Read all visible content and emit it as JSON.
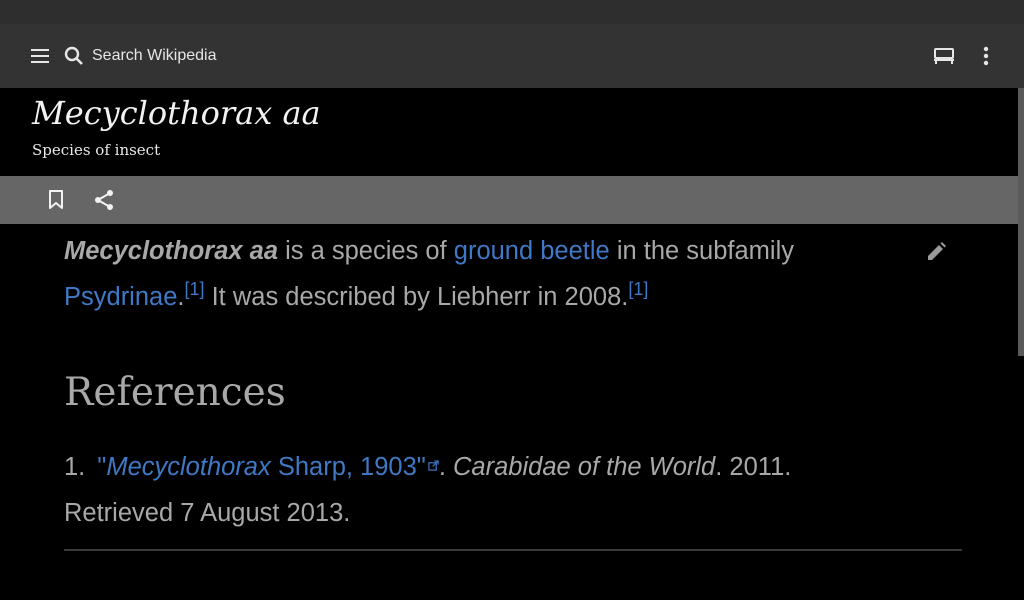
{
  "toolbar": {
    "search_placeholder": "Search Wikipedia",
    "menu_icon": "hamburger-menu-icon",
    "search_icon": "search-icon",
    "reading_list_icon": "reading-list-icon",
    "overflow_icon": "more-vertical-icon"
  },
  "article": {
    "title": "Mecyclothorax aa",
    "description": "Species of insect",
    "actions": {
      "save_icon": "bookmark-icon",
      "share_icon": "share-icon"
    },
    "lead": {
      "term": "Mecyclothorax aa",
      "text1": " is a species of ",
      "link1": "ground beetle",
      "text2": " in the subfamily ",
      "link2": "Psydrinae",
      "text3": ".",
      "ref1": "[1]",
      "text4": " It was described by Liebherr in 2008.",
      "ref2": "[1]"
    },
    "edit_icon": "pencil-icon",
    "references_heading": "References",
    "references": [
      {
        "number": "1.",
        "title_italic": "Mecyclothorax",
        "title_rest": " Sharp, 1903",
        "quote_open": "\"",
        "quote_close": "\"",
        "sep": ". ",
        "work": "Carabidae of the World",
        "tail1": ". 2011.",
        "tail2": "Retrieved 7 August 2013."
      }
    ]
  },
  "colors": {
    "link": "#3f78c4",
    "text": "#a8a8a8",
    "toolbar": "#333333",
    "actionbar": "#666666"
  }
}
